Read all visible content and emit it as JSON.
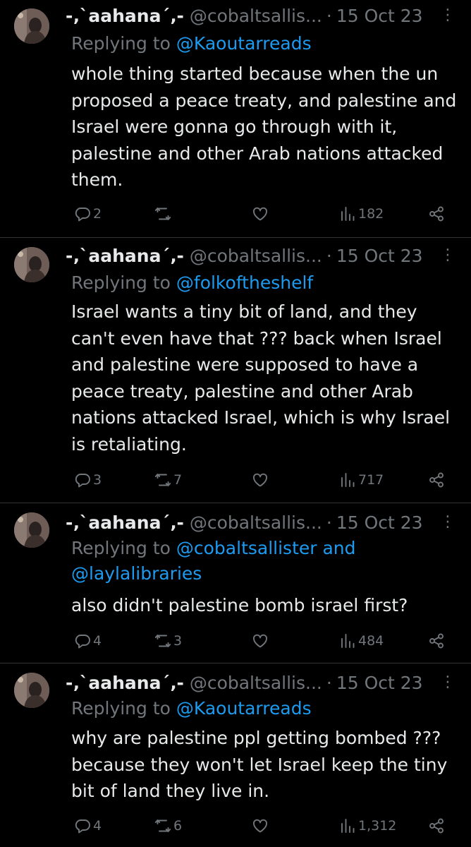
{
  "colors": {
    "background": "#000000",
    "text": "#e7e9ea",
    "muted": "#71767b",
    "link": "#1d9bf0",
    "divider": "#2f3336"
  },
  "tweets": [
    {
      "name": "-‚`aahana´‚-",
      "handle": "@cobaltsallis...",
      "separator": "·",
      "date": "15 Oct 23",
      "reply_prefix": "Replying to ",
      "reply_to": "@Kaoutarreads",
      "text": "whole thing started because when the un proposed a peace treaty, and palestine and Israel were gonna go through with it, palestine and other Arab nations attacked them.",
      "replies": "2",
      "reposts": "",
      "likes": "",
      "views": "182"
    },
    {
      "name": "-‚`aahana´‚-",
      "handle": "@cobaltsallis...",
      "separator": "·",
      "date": "15 Oct 23",
      "reply_prefix": "Replying to ",
      "reply_to": "@folkoftheshelf",
      "text": "Israel wants a tiny bit of land, and they can't even have that ??? back when Israel and palestine were supposed to have a peace treaty, palestine and other Arab nations attacked Israel, which is why Israel is retaliating.",
      "replies": "3",
      "reposts": "7",
      "likes": "",
      "views": "717"
    },
    {
      "name": "-‚`aahana´‚-",
      "handle": "@cobaltsallis...",
      "separator": "·",
      "date": "15 Oct 23",
      "reply_prefix": "Replying to ",
      "reply_to": "@cobaltsallister and @laylalibraries",
      "text": "also didn't palestine bomb israel first?",
      "replies": "4",
      "reposts": "3",
      "likes": "",
      "views": "484"
    },
    {
      "name": "-‚`aahana´‚-",
      "handle": "@cobaltsallis...",
      "separator": "·",
      "date": "15 Oct 23",
      "reply_prefix": "Replying to ",
      "reply_to": "@Kaoutarreads",
      "text": "why are palestine ppl getting bombed ??? because they won't let Israel keep the tiny bit of land they live in.",
      "replies": "4",
      "reposts": "6",
      "likes": "",
      "views": "1,312"
    }
  ]
}
